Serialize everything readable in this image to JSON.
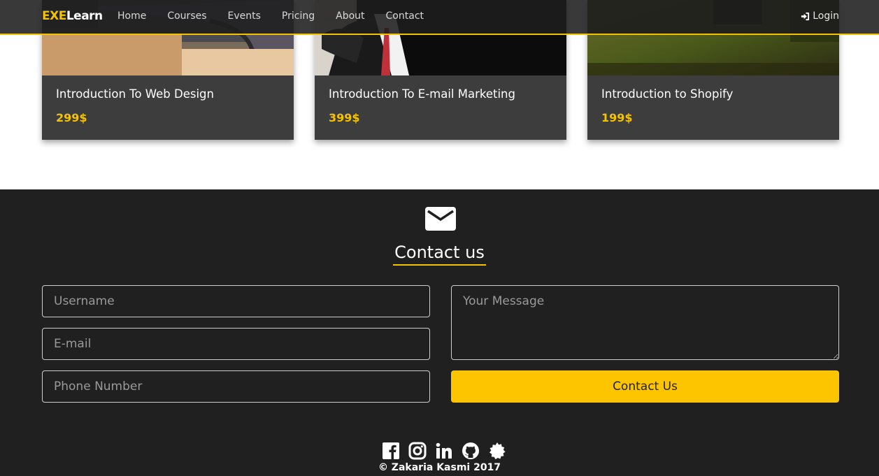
{
  "navbar": {
    "brand_part1": "EXE",
    "brand_part2": "Learn",
    "links": [
      "Home",
      "Courses",
      "Events",
      "Pricing",
      "About",
      "Contact"
    ],
    "login_label": "Login",
    "accent_color": "#f5c200"
  },
  "courses": [
    {
      "title": "Introduction To Web Design",
      "price": "299$",
      "image": "office-interior-photo"
    },
    {
      "title": "Introduction To E-mail Marketing",
      "price": "399$",
      "image": "businessman-suit-photo"
    },
    {
      "title": "Introduction to Shopify",
      "price": "199$",
      "image": "green-interior-photo"
    }
  ],
  "contact": {
    "icon": "envelope-icon",
    "title": "Contact us",
    "username_placeholder": "Username",
    "email_placeholder": "E-mail",
    "phone_placeholder": "Phone Number",
    "message_placeholder": "Your Message",
    "submit_label": "Contact Us",
    "button_color": "#fcc500"
  },
  "footer": {
    "social_icons": [
      "facebook-icon",
      "instagram-icon",
      "linkedin-icon",
      "github-icon",
      "badge-icon"
    ],
    "copyright": "© Zakaria Kasmi 2017"
  }
}
